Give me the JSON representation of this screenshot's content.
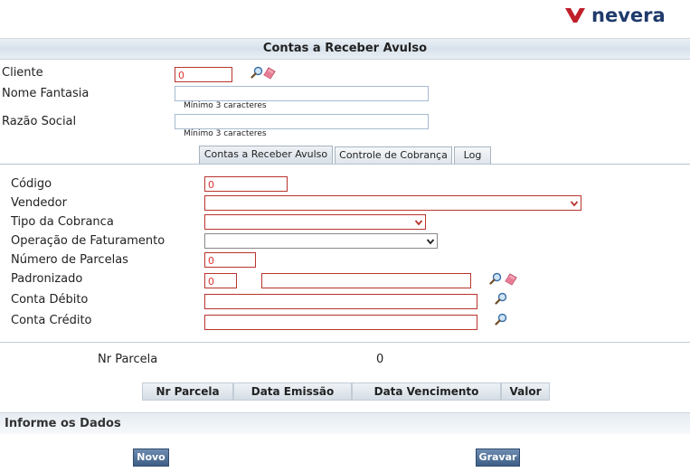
{
  "brand": {
    "name": "nevera",
    "color": "#1f3a6b",
    "mark_color": "#c0202a"
  },
  "page": {
    "title": "Contas a Receber Avulso"
  },
  "top_form": {
    "cliente_label": "Cliente",
    "cliente_value": "0",
    "nome_fantasia_label": "Nome Fantasia",
    "nome_fantasia_value": "",
    "nome_fantasia_hint": "Mínimo 3 caracteres",
    "razao_social_label": "Razão Social",
    "razao_social_value": "",
    "razao_social_hint": "Mínimo 3 caracteres"
  },
  "tabs": [
    {
      "label": "Contas a Receber Avulso",
      "active": true
    },
    {
      "label": "Controle de Cobrança",
      "active": false
    },
    {
      "label": "Log",
      "active": false
    }
  ],
  "form": {
    "codigo_label": "Código",
    "codigo_value": "0",
    "vendedor_label": "Vendedor",
    "vendedor_value": "",
    "tipo_cobranca_label": "Tipo da Cobranca",
    "tipo_cobranca_value": "",
    "operacao_label": "Operação de Faturamento",
    "operacao_value": "",
    "numero_parcelas_label": "Número de Parcelas",
    "numero_parcelas_value": "0",
    "padronizado_label": "Padronizado",
    "padronizado_code": "0",
    "padronizado_desc": "",
    "conta_debito_label": "Conta Débito",
    "conta_debito_value": "",
    "conta_credito_label": "Conta Crédito",
    "conta_credito_value": ""
  },
  "parcela": {
    "label": "Nr Parcela",
    "value": "0"
  },
  "table_headers": [
    "Nr Parcela",
    "Data Emissão",
    "Data Vencimento",
    "Valor"
  ],
  "info_section": {
    "title": "Informe os Dados"
  },
  "buttons": {
    "novo": "Novo",
    "gravar": "Gravar"
  },
  "icons": {
    "search": "magnifier-icon",
    "clear": "eraser-icon"
  },
  "colors": {
    "required_border": "#b9342c",
    "header_bg": "#dde5ed",
    "button_bg": "#4a6a92"
  }
}
